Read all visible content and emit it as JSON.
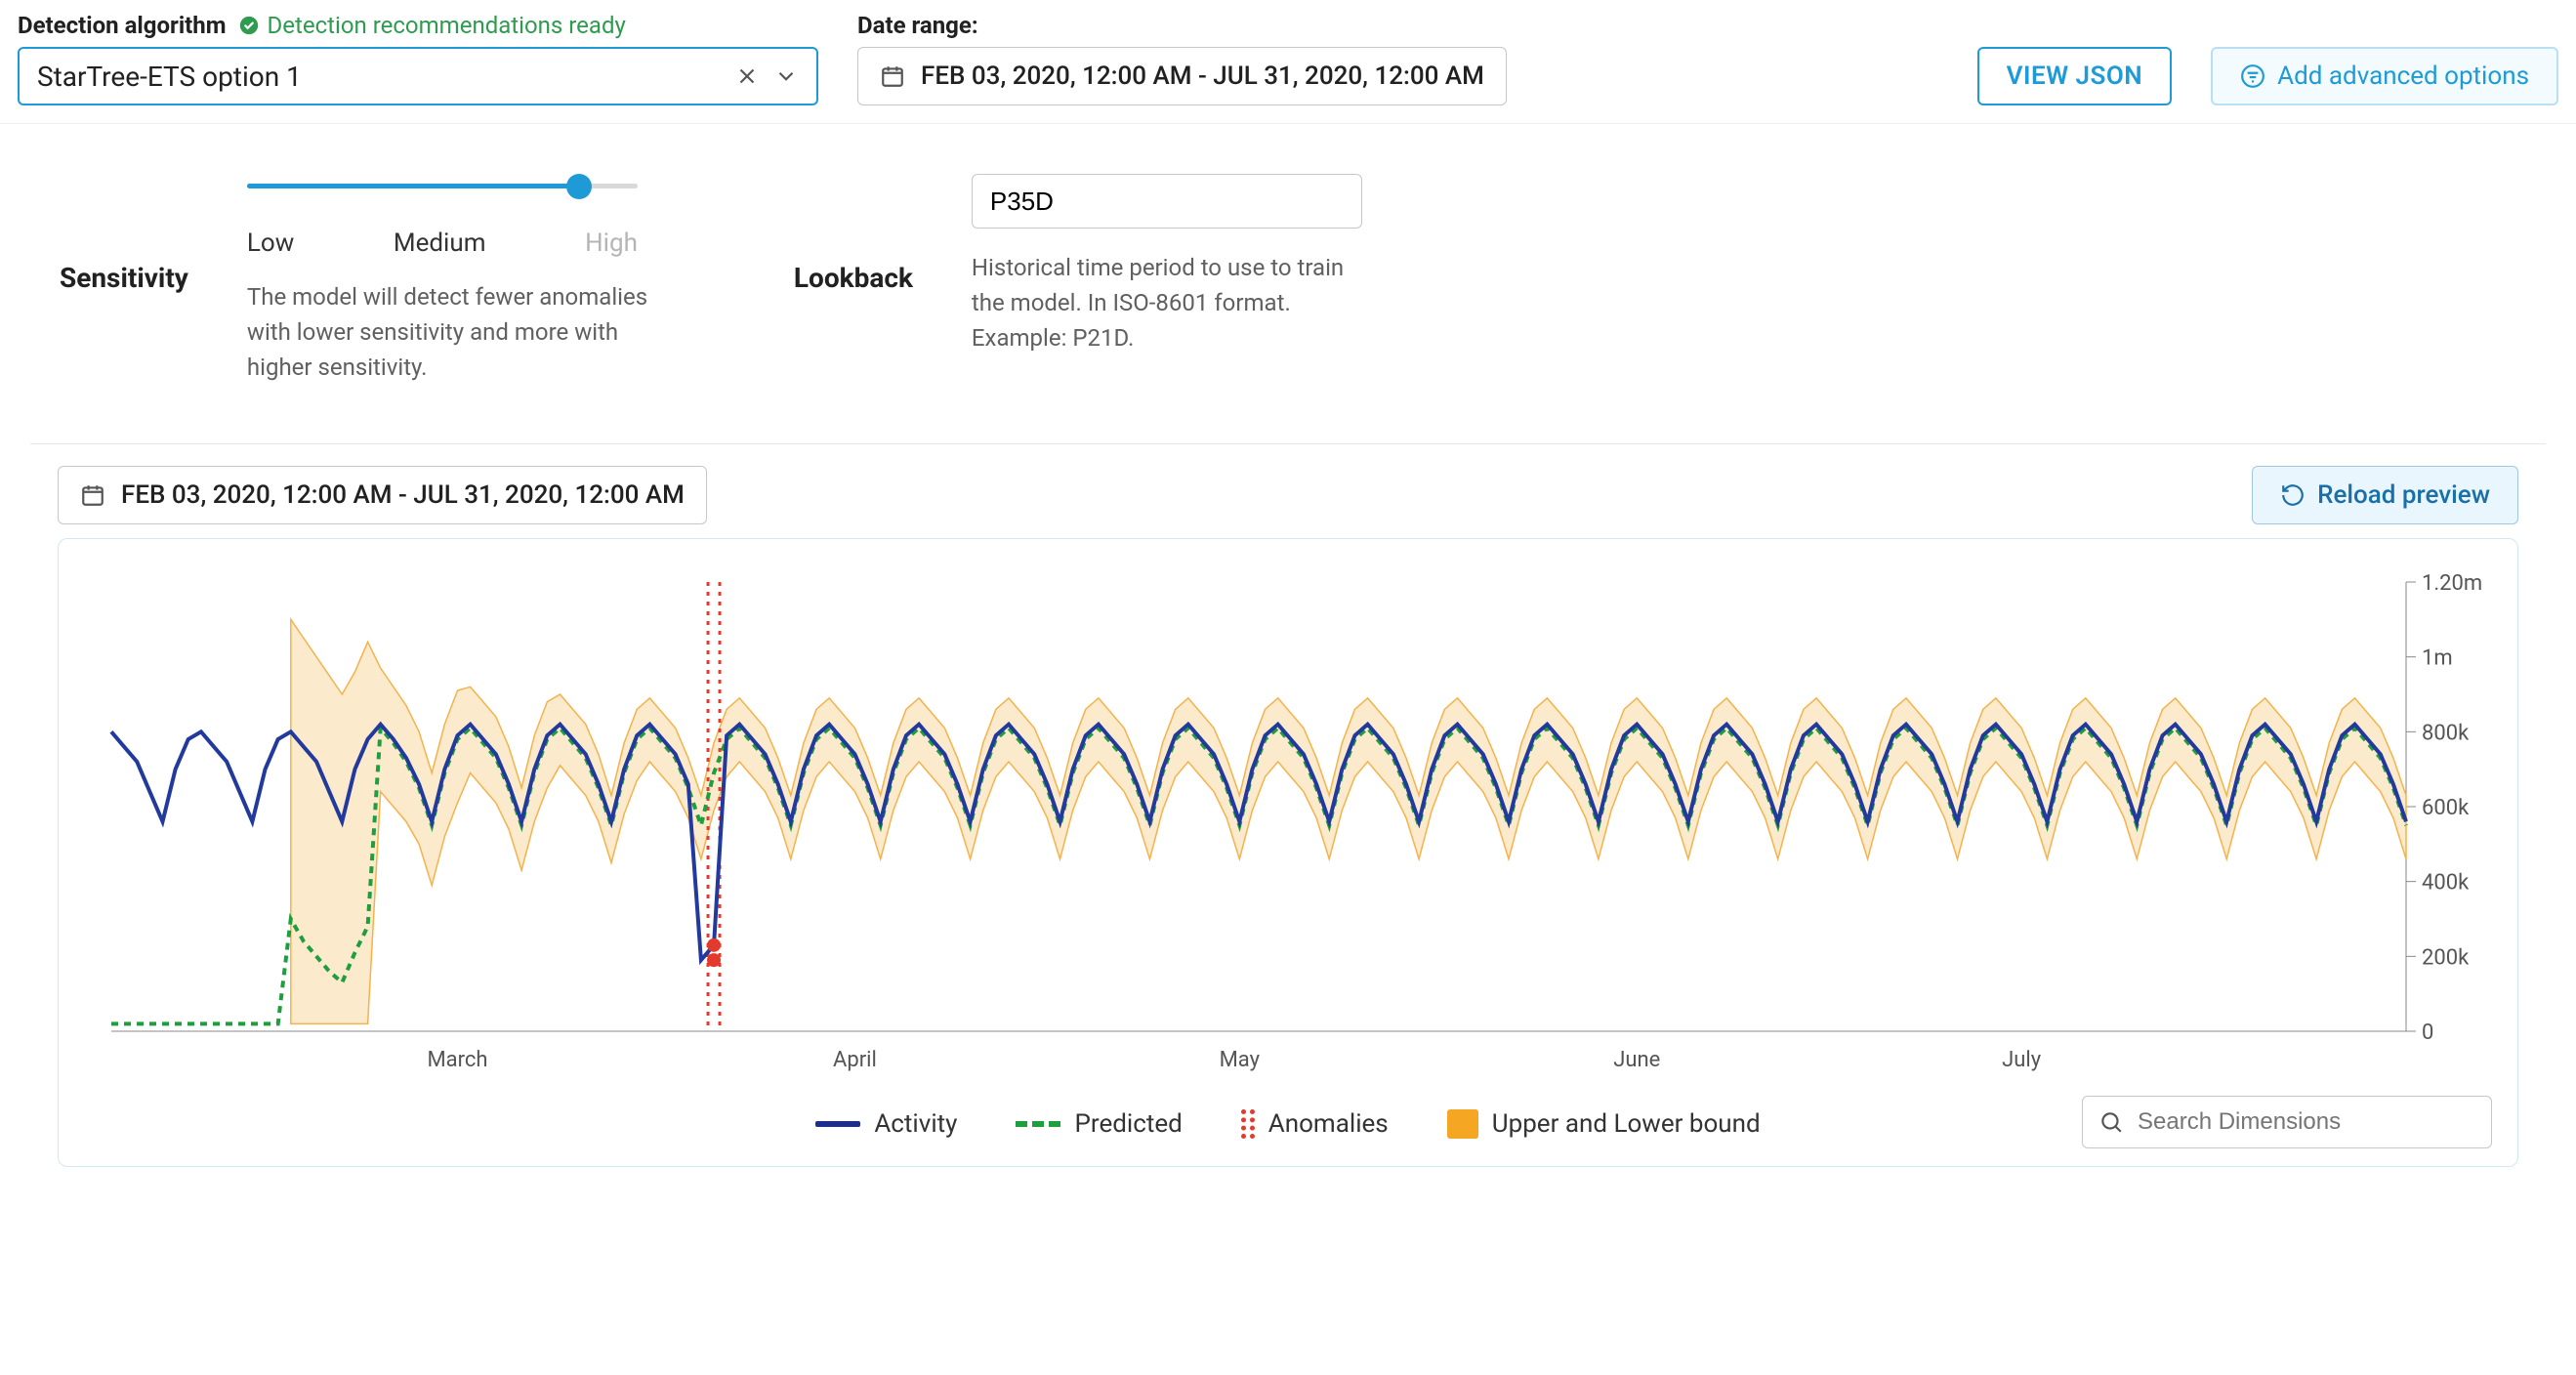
{
  "header": {
    "algorithm_label": "Detection algorithm",
    "recommendations_ready": "Detection recommendations ready",
    "algorithm_value": "StarTree-ETS option 1",
    "date_range_label": "Date range:",
    "date_range_value": "FEB 03, 2020, 12:00 AM - JUL 31, 2020, 12:00 AM",
    "view_json": "VIEW JSON",
    "add_advanced": "Add advanced options"
  },
  "config": {
    "sensitivity": {
      "title": "Sensitivity",
      "low": "Low",
      "medium": "Medium",
      "high": "High",
      "value_pct": 85,
      "help": "The model will detect fewer anomalies with lower sensitivity and more with higher sensitivity."
    },
    "lookback": {
      "title": "Lookback",
      "value": "P35D",
      "help": "Historical time period to use to train the model. In ISO-8601 format. Example: P21D."
    }
  },
  "preview": {
    "date_range_value": "FEB 03, 2020, 12:00 AM - JUL 31, 2020, 12:00 AM",
    "reload": "Reload preview",
    "search_placeholder": "Search Dimensions",
    "legend": {
      "activity": "Activity",
      "predicted": "Predicted",
      "anomalies": "Anomalies",
      "bound": "Upper and Lower bound"
    }
  },
  "chart_data": {
    "type": "line",
    "title": "",
    "xlabel": "",
    "ylabel": "",
    "ylim": [
      0,
      1200000
    ],
    "y_ticks": [
      0,
      200000,
      400000,
      600000,
      800000,
      1000000,
      1200000
    ],
    "y_tick_labels": [
      "0",
      "200k",
      "400k",
      "600k",
      "800k",
      "1m",
      "1.20m"
    ],
    "x_tick_labels": [
      "March",
      "April",
      "May",
      "June",
      "July"
    ],
    "x_tick_positions": [
      27,
      58,
      88,
      119,
      149
    ],
    "x_range": [
      0,
      179
    ],
    "anomaly_day": 47,
    "colors": {
      "activity": "#223a9e",
      "predicted": "#1f9e3e",
      "band": "#f6b24a",
      "anomaly": "#e23b2e"
    },
    "series": [
      {
        "name": "Activity",
        "style": "solid",
        "color": "#223a9e",
        "values": [
          800000,
          760000,
          720000,
          640000,
          560000,
          700000,
          780000,
          800000,
          760000,
          720000,
          640000,
          560000,
          700000,
          780000,
          800000,
          760000,
          720000,
          640000,
          560000,
          700000,
          780000,
          820000,
          780000,
          730000,
          660000,
          560000,
          700000,
          790000,
          820000,
          780000,
          740000,
          660000,
          560000,
          700000,
          790000,
          820000,
          780000,
          740000,
          660000,
          560000,
          700000,
          790000,
          820000,
          780000,
          740000,
          660000,
          190000,
          230000,
          790000,
          820000,
          780000,
          740000,
          660000,
          560000,
          700000,
          790000,
          820000,
          780000,
          740000,
          660000,
          560000,
          700000,
          790000,
          820000,
          780000,
          740000,
          660000,
          560000,
          700000,
          790000,
          820000,
          780000,
          740000,
          660000,
          560000,
          700000,
          790000,
          820000,
          780000,
          740000,
          660000,
          560000,
          700000,
          790000,
          820000,
          780000,
          740000,
          660000,
          560000,
          700000,
          790000,
          820000,
          780000,
          740000,
          660000,
          560000,
          700000,
          790000,
          820000,
          780000,
          740000,
          660000,
          560000,
          700000,
          790000,
          820000,
          780000,
          740000,
          660000,
          560000,
          700000,
          790000,
          820000,
          780000,
          740000,
          660000,
          560000,
          700000,
          790000,
          820000,
          780000,
          740000,
          660000,
          560000,
          700000,
          790000,
          820000,
          780000,
          740000,
          660000,
          560000,
          700000,
          790000,
          820000,
          780000,
          740000,
          660000,
          560000,
          700000,
          790000,
          820000,
          780000,
          740000,
          660000,
          560000,
          700000,
          790000,
          820000,
          780000,
          740000,
          660000,
          560000,
          700000,
          790000,
          820000,
          780000,
          740000,
          660000,
          560000,
          700000,
          790000,
          820000,
          780000,
          740000,
          660000,
          560000,
          700000,
          790000,
          820000,
          780000,
          740000,
          660000,
          560000,
          700000,
          790000,
          820000,
          780000,
          740000,
          660000,
          560000
        ]
      },
      {
        "name": "Predicted",
        "style": "dashed",
        "color": "#1f9e3e",
        "values": [
          20000,
          20000,
          20000,
          20000,
          20000,
          20000,
          20000,
          20000,
          20000,
          20000,
          20000,
          20000,
          20000,
          20000,
          300000,
          240000,
          200000,
          160000,
          130000,
          210000,
          280000,
          810000,
          770000,
          720000,
          650000,
          550000,
          690000,
          780000,
          810000,
          770000,
          730000,
          650000,
          550000,
          690000,
          780000,
          810000,
          770000,
          730000,
          650000,
          550000,
          690000,
          780000,
          810000,
          770000,
          730000,
          650000,
          550000,
          690000,
          780000,
          810000,
          770000,
          730000,
          650000,
          550000,
          690000,
          780000,
          810000,
          770000,
          730000,
          650000,
          550000,
          690000,
          780000,
          810000,
          770000,
          730000,
          650000,
          550000,
          690000,
          780000,
          810000,
          770000,
          730000,
          650000,
          550000,
          690000,
          780000,
          810000,
          770000,
          730000,
          650000,
          550000,
          690000,
          780000,
          810000,
          770000,
          730000,
          650000,
          550000,
          690000,
          780000,
          810000,
          770000,
          730000,
          650000,
          550000,
          690000,
          780000,
          810000,
          770000,
          730000,
          650000,
          550000,
          690000,
          780000,
          810000,
          770000,
          730000,
          650000,
          550000,
          690000,
          780000,
          810000,
          770000,
          730000,
          650000,
          550000,
          690000,
          780000,
          810000,
          770000,
          730000,
          650000,
          550000,
          690000,
          780000,
          810000,
          770000,
          730000,
          650000,
          550000,
          690000,
          780000,
          810000,
          770000,
          730000,
          650000,
          550000,
          690000,
          780000,
          810000,
          770000,
          730000,
          650000,
          550000,
          690000,
          780000,
          810000,
          770000,
          730000,
          650000,
          550000,
          690000,
          780000,
          810000,
          770000,
          730000,
          650000,
          550000,
          690000,
          780000,
          810000,
          770000,
          730000,
          650000,
          550000,
          690000,
          780000,
          810000,
          770000,
          730000,
          650000,
          550000,
          690000,
          780000,
          810000,
          770000,
          730000,
          650000,
          550000
        ]
      },
      {
        "name": "Upper bound",
        "style": "band-upper",
        "color": "#f6b24a",
        "values": [
          null,
          null,
          null,
          null,
          null,
          null,
          null,
          null,
          null,
          null,
          null,
          null,
          null,
          null,
          1100000,
          1050000,
          1000000,
          950000,
          900000,
          960000,
          1040000,
          970000,
          920000,
          870000,
          800000,
          690000,
          820000,
          910000,
          920000,
          880000,
          840000,
          760000,
          650000,
          790000,
          880000,
          900000,
          860000,
          820000,
          740000,
          630000,
          770000,
          860000,
          890000,
          850000,
          810000,
          730000,
          630000,
          770000,
          860000,
          890000,
          850000,
          810000,
          730000,
          630000,
          770000,
          860000,
          890000,
          850000,
          810000,
          730000,
          630000,
          770000,
          860000,
          890000,
          850000,
          810000,
          730000,
          630000,
          770000,
          860000,
          890000,
          850000,
          810000,
          730000,
          630000,
          770000,
          860000,
          890000,
          850000,
          810000,
          730000,
          630000,
          770000,
          860000,
          890000,
          850000,
          810000,
          730000,
          630000,
          770000,
          860000,
          890000,
          850000,
          810000,
          730000,
          630000,
          770000,
          860000,
          890000,
          850000,
          810000,
          730000,
          630000,
          770000,
          860000,
          890000,
          850000,
          810000,
          730000,
          630000,
          770000,
          860000,
          890000,
          850000,
          810000,
          730000,
          630000,
          770000,
          860000,
          890000,
          850000,
          810000,
          730000,
          630000,
          770000,
          860000,
          890000,
          850000,
          810000,
          730000,
          630000,
          770000,
          860000,
          890000,
          850000,
          810000,
          730000,
          630000,
          770000,
          860000,
          890000,
          850000,
          810000,
          730000,
          630000,
          770000,
          860000,
          890000,
          850000,
          810000,
          730000,
          630000,
          770000,
          860000,
          890000,
          850000,
          810000,
          730000,
          630000,
          770000,
          860000,
          890000,
          850000,
          810000,
          730000,
          630000,
          770000,
          860000,
          890000,
          850000,
          810000,
          730000,
          630000,
          770000,
          860000,
          890000,
          850000,
          810000,
          730000,
          630000
        ]
      },
      {
        "name": "Lower bound",
        "style": "band-lower",
        "color": "#f6b24a",
        "values": [
          null,
          null,
          null,
          null,
          null,
          null,
          null,
          null,
          null,
          null,
          null,
          null,
          null,
          null,
          20000,
          20000,
          20000,
          20000,
          20000,
          20000,
          20000,
          640000,
          600000,
          560000,
          500000,
          390000,
          520000,
          610000,
          690000,
          650000,
          610000,
          540000,
          430000,
          560000,
          650000,
          710000,
          670000,
          630000,
          560000,
          450000,
          580000,
          670000,
          720000,
          680000,
          640000,
          570000,
          460000,
          590000,
          680000,
          720000,
          680000,
          640000,
          570000,
          460000,
          590000,
          680000,
          720000,
          680000,
          640000,
          570000,
          460000,
          590000,
          680000,
          720000,
          680000,
          640000,
          570000,
          460000,
          590000,
          680000,
          720000,
          680000,
          640000,
          570000,
          460000,
          590000,
          680000,
          720000,
          680000,
          640000,
          570000,
          460000,
          590000,
          680000,
          720000,
          680000,
          640000,
          570000,
          460000,
          590000,
          680000,
          720000,
          680000,
          640000,
          570000,
          460000,
          590000,
          680000,
          720000,
          680000,
          640000,
          570000,
          460000,
          590000,
          680000,
          720000,
          680000,
          640000,
          570000,
          460000,
          590000,
          680000,
          720000,
          680000,
          640000,
          570000,
          460000,
          590000,
          680000,
          720000,
          680000,
          640000,
          570000,
          460000,
          590000,
          680000,
          720000,
          680000,
          640000,
          570000,
          460000,
          590000,
          680000,
          720000,
          680000,
          640000,
          570000,
          460000,
          590000,
          680000,
          720000,
          680000,
          640000,
          570000,
          460000,
          590000,
          680000,
          720000,
          680000,
          640000,
          570000,
          460000,
          590000,
          680000,
          720000,
          680000,
          640000,
          570000,
          460000,
          590000,
          680000,
          720000,
          680000,
          640000,
          570000,
          460000,
          590000,
          680000,
          720000,
          680000,
          640000,
          570000,
          460000,
          590000,
          680000,
          720000,
          680000,
          640000,
          570000,
          460000
        ]
      }
    ]
  }
}
